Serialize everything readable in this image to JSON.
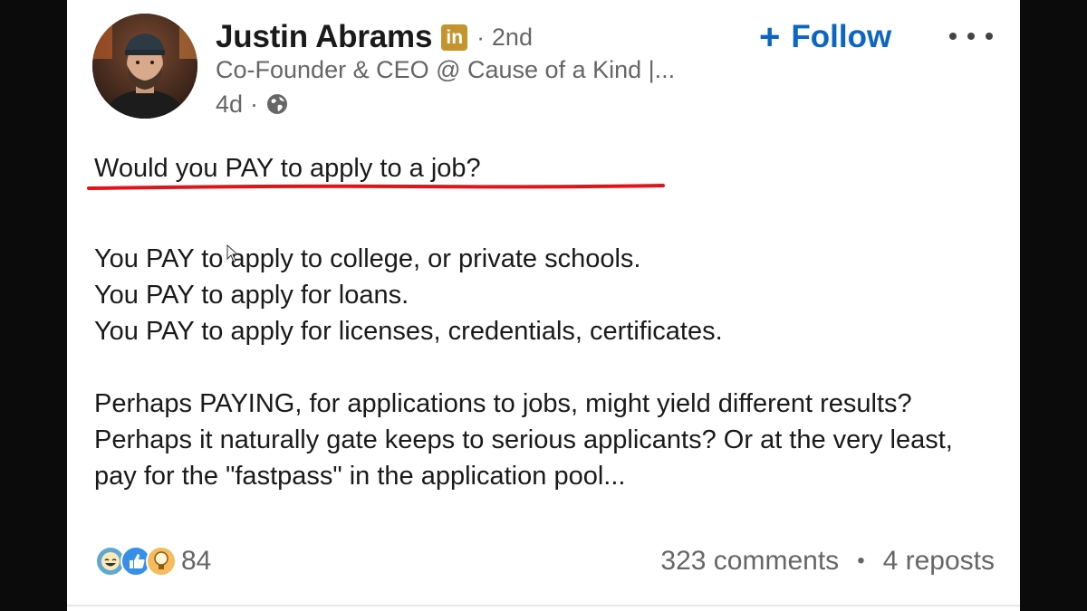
{
  "post": {
    "author": {
      "name": "Justin Abrams",
      "badge": "in",
      "degree": "2nd",
      "headline": "Co-Founder & CEO @ Cause of a Kind |...",
      "time": "4d",
      "visibility_icon": "globe-icon"
    },
    "follow_label": "Follow",
    "more_icon": "more-options-icon",
    "body": {
      "question": "Would you PAY to apply to a job?",
      "lines": [
        "You PAY to apply to college, or private schools.",
        "You PAY to apply for loans.",
        "You PAY to apply for licenses, credentials, certificates."
      ],
      "paragraph": "Perhaps PAYING, for applications to jobs, might yield different results? Perhaps it naturally gate keeps to serious applicants? Or at the very least, pay for the \"fastpass\" in the application pool..."
    },
    "stats": {
      "reactions_count": "84",
      "reaction_icons": [
        "funny-icon",
        "like-icon",
        "insightful-icon"
      ],
      "comments": "323 comments",
      "reposts": "4 reposts"
    }
  },
  "colors": {
    "follow_blue": "#0a66c2",
    "underline_red": "#e0151b",
    "badge_gold": "#c4942f",
    "muted_text": "#666666"
  }
}
